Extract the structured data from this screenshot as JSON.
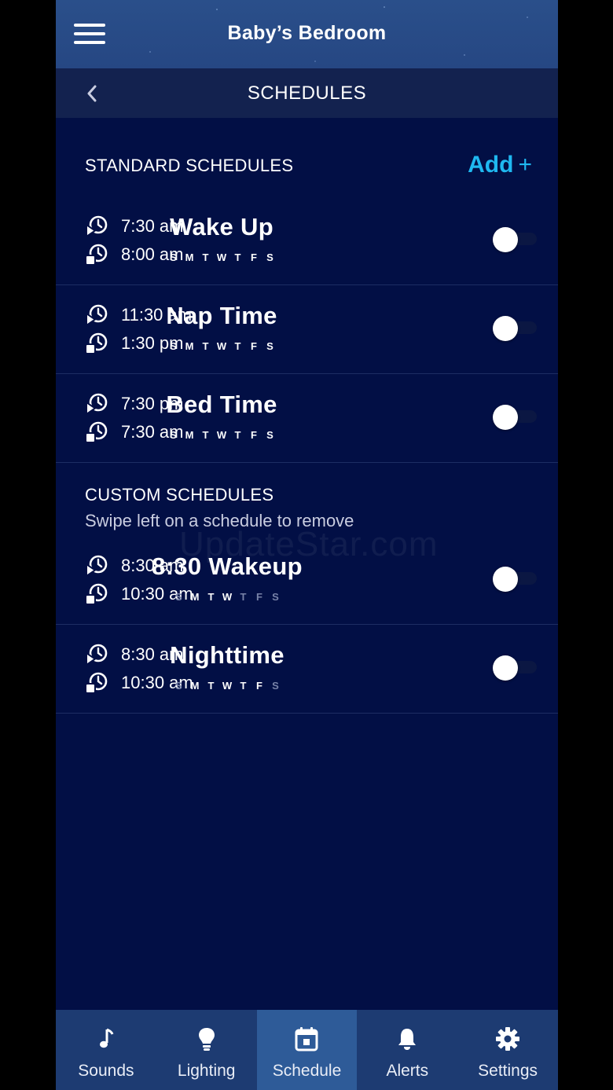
{
  "header": {
    "title": "Baby’s Bedroom"
  },
  "subheader": {
    "title": "SCHEDULES"
  },
  "standard": {
    "label": "STANDARD SCHEDULES",
    "add_label": "Add",
    "add_plus": "+"
  },
  "custom": {
    "label": "CUSTOM SCHEDULES",
    "hint": "Swipe left on a schedule to remove"
  },
  "watermark": "UpdateStar.com",
  "schedules": [
    {
      "start": "7:30 am",
      "end": "8:00 am",
      "name": "Wake Up",
      "days": [
        "S",
        "M",
        "T",
        "W",
        "T",
        "F",
        "S"
      ],
      "enabled": false
    },
    {
      "start": "11:30 am",
      "end": "1:30 pm",
      "name": "Nap Time",
      "days": [
        "S",
        "M",
        "T",
        "W",
        "T",
        "F",
        "S"
      ],
      "enabled": false
    },
    {
      "start": "7:30 pm",
      "end": "7:30 am",
      "name": "Bed Time",
      "days": [
        "S",
        "M",
        "T",
        "W",
        "T",
        "F",
        "S"
      ],
      "enabled": false
    },
    {
      "start": "8:30 am",
      "end": "10:30 am",
      "name": "8:30 Wakeup",
      "days": [
        "S",
        "M",
        "T",
        "W",
        "T",
        "F",
        "S"
      ],
      "active_days": [
        false,
        true,
        true,
        true,
        false,
        false,
        false
      ],
      "enabled": false
    },
    {
      "start": "8:30 am",
      "end": "10:30 am",
      "name": "Nighttime",
      "days": [
        "S",
        "M",
        "T",
        "W",
        "T",
        "F",
        "S"
      ],
      "active_days": [
        false,
        true,
        true,
        true,
        true,
        true,
        false
      ],
      "enabled": false
    }
  ],
  "nav": [
    {
      "label": "Sounds",
      "icon": "music-note-icon",
      "active": false
    },
    {
      "label": "Lighting",
      "icon": "lightbulb-icon",
      "active": false
    },
    {
      "label": "Schedule",
      "icon": "calendar-icon",
      "active": true
    },
    {
      "label": "Alerts",
      "icon": "bell-icon",
      "active": false
    },
    {
      "label": "Settings",
      "icon": "gear-icon",
      "active": false
    }
  ],
  "colors": {
    "background": "#020f45",
    "header": "#264783",
    "accent": "#1fb8f0",
    "nav": "#1d3b72",
    "nav_active": "#2e5b98"
  }
}
